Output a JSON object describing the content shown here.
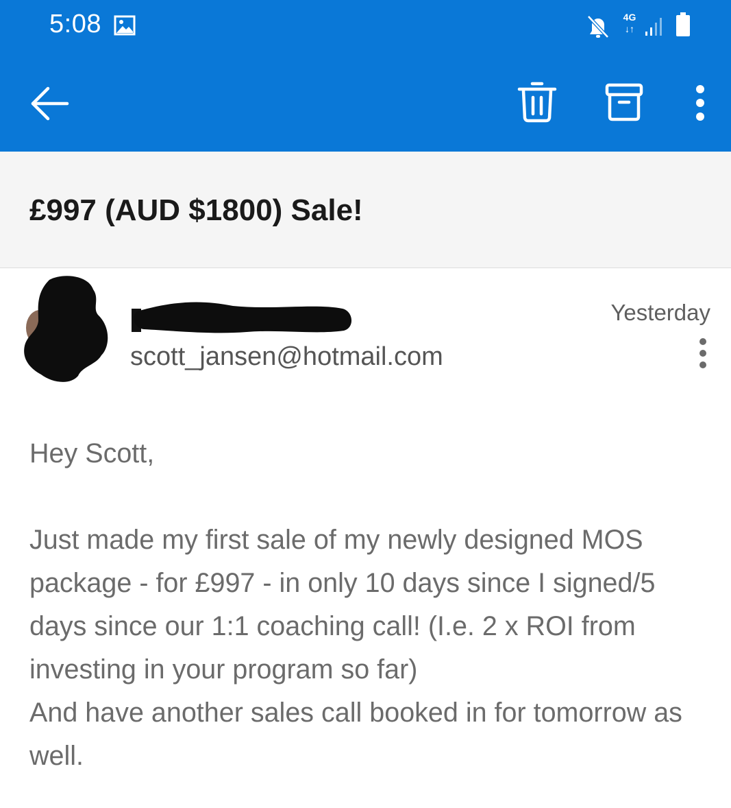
{
  "status_bar": {
    "time": "5:08",
    "network_type": "4G",
    "network_arrows": "↓↑",
    "icons": [
      "image-icon",
      "mute-icon",
      "signal-icon",
      "battery-icon"
    ]
  },
  "toolbar": {
    "back_icon": "arrow-left-icon",
    "delete_icon": "trash-icon",
    "archive_icon": "archive-icon",
    "more_icon": "more-vertical-icon"
  },
  "email": {
    "subject": "£997 (AUD $1800) Sale!",
    "sender_email": "scott_jansen@hotmail.com",
    "time": "Yesterday",
    "greeting": "Hey Scott,",
    "body_paragraph_1": "Just made my first sale of my newly designed MOS package - for £997 - in only 10 days since I signed/5 days since our 1:1 coaching call! (I.e. 2 x ROI from investing in your program so far)",
    "body_paragraph_2": "And have another sales call booked in for tomorrow as well."
  },
  "colors": {
    "header_blue": "#0a78d7",
    "subject_bg": "#f5f5f5",
    "body_text": "#6b6b6b"
  }
}
